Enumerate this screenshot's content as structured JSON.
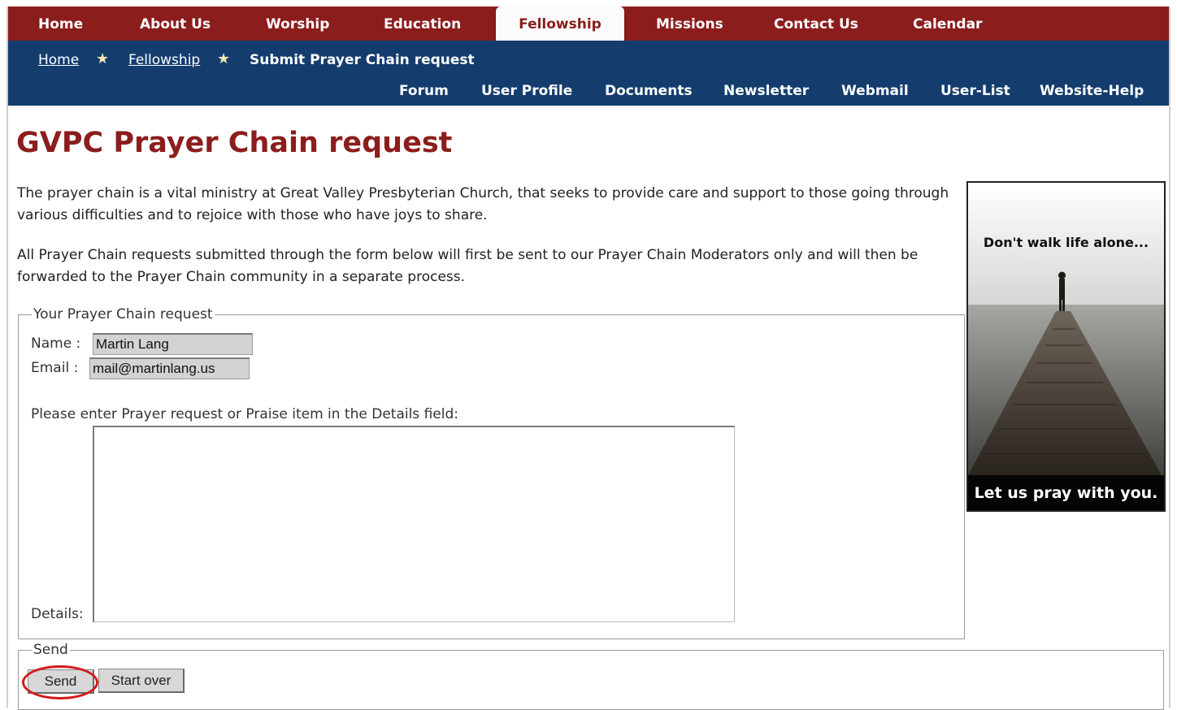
{
  "topnav": {
    "items": [
      {
        "label": "Home"
      },
      {
        "label": "About Us"
      },
      {
        "label": "Worship"
      },
      {
        "label": "Education"
      },
      {
        "label": "Fellowship"
      },
      {
        "label": "Missions"
      },
      {
        "label": "Contact Us"
      },
      {
        "label": "Calendar"
      }
    ],
    "active": "Fellowship"
  },
  "breadcrumb": {
    "home": "Home",
    "section": "Fellowship",
    "current": "Submit Prayer Chain request",
    "separator": "★"
  },
  "subnav": {
    "items": [
      {
        "label": "Forum"
      },
      {
        "label": "User Profile"
      },
      {
        "label": "Documents"
      },
      {
        "label": "Newsletter"
      },
      {
        "label": "Webmail"
      },
      {
        "label": "User-List"
      },
      {
        "label": "Website-Help"
      }
    ]
  },
  "page": {
    "title": "GVPC Prayer Chain request",
    "intro": "The prayer chain is a vital ministry at Great Valley Presbyterian Church, that seeks to provide care and support to those going through various difficulties and to rejoice with those who have joys to share.",
    "note": "All Prayer Chain requests submitted through the form below will first be sent to our Prayer Chain Moderators only and will then be forwarded to the Prayer Chain community in a separate process."
  },
  "form": {
    "legend": "Your Prayer Chain request",
    "name_label": "Name :",
    "name_value": "Martin Lang",
    "email_label": "Email :",
    "email_value": "mail@martinlang.us",
    "instructions": "Please enter Prayer request or Praise item in the Details field:",
    "details_label": "Details:",
    "details_value": ""
  },
  "send": {
    "legend": "Send",
    "send_label": "Send",
    "startover_label": "Start over"
  },
  "ad": {
    "top_text": "Don't walk life alone...",
    "bottom_text": "Let us pray with you."
  },
  "colors": {
    "topnav_bg": "#8c1d1d",
    "bluebar_bg": "#143d6e",
    "title": "#8c1d1d",
    "highlight": "#d41a1a"
  }
}
